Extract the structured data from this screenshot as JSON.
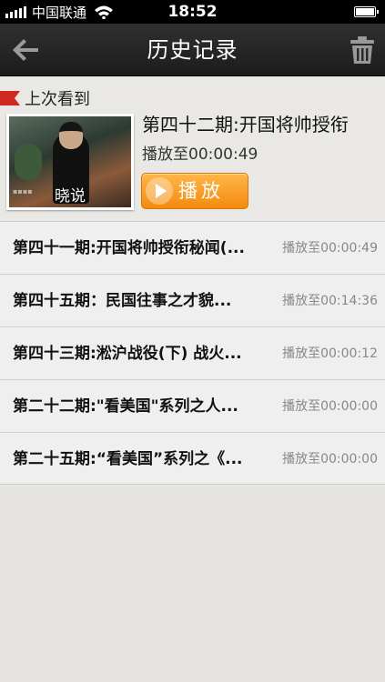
{
  "status_bar": {
    "carrier": "中国联通",
    "time": "18:52"
  },
  "nav": {
    "title": "历史记录",
    "back_icon": "back-arrow-icon",
    "trash_icon": "trash-icon"
  },
  "last_watched": {
    "label": "上次看到",
    "thumbnail_caption": "晓说",
    "title": "第四十二期:开国将帅授衔",
    "progress": "播放至00:00:49",
    "play_label": "播放",
    "colors": {
      "flag": "#d0281e",
      "play_button": "#f7931e"
    }
  },
  "history": [
    {
      "title": "第四十一期:开国将帅授衔秘闻(...",
      "progress": "播放至00:00:49"
    },
    {
      "title": "第四十五期：民国往事之才貌...",
      "progress": "播放至00:14:36"
    },
    {
      "title": "第四十三期:淞沪战役(下) 战火...",
      "progress": "播放至00:00:12"
    },
    {
      "title": "第二十二期:\"看美国\"系列之人...",
      "progress": "播放至00:00:00"
    },
    {
      "title": "第二十五期:“看美国”系列之《...",
      "progress": "播放至00:00:00"
    }
  ]
}
